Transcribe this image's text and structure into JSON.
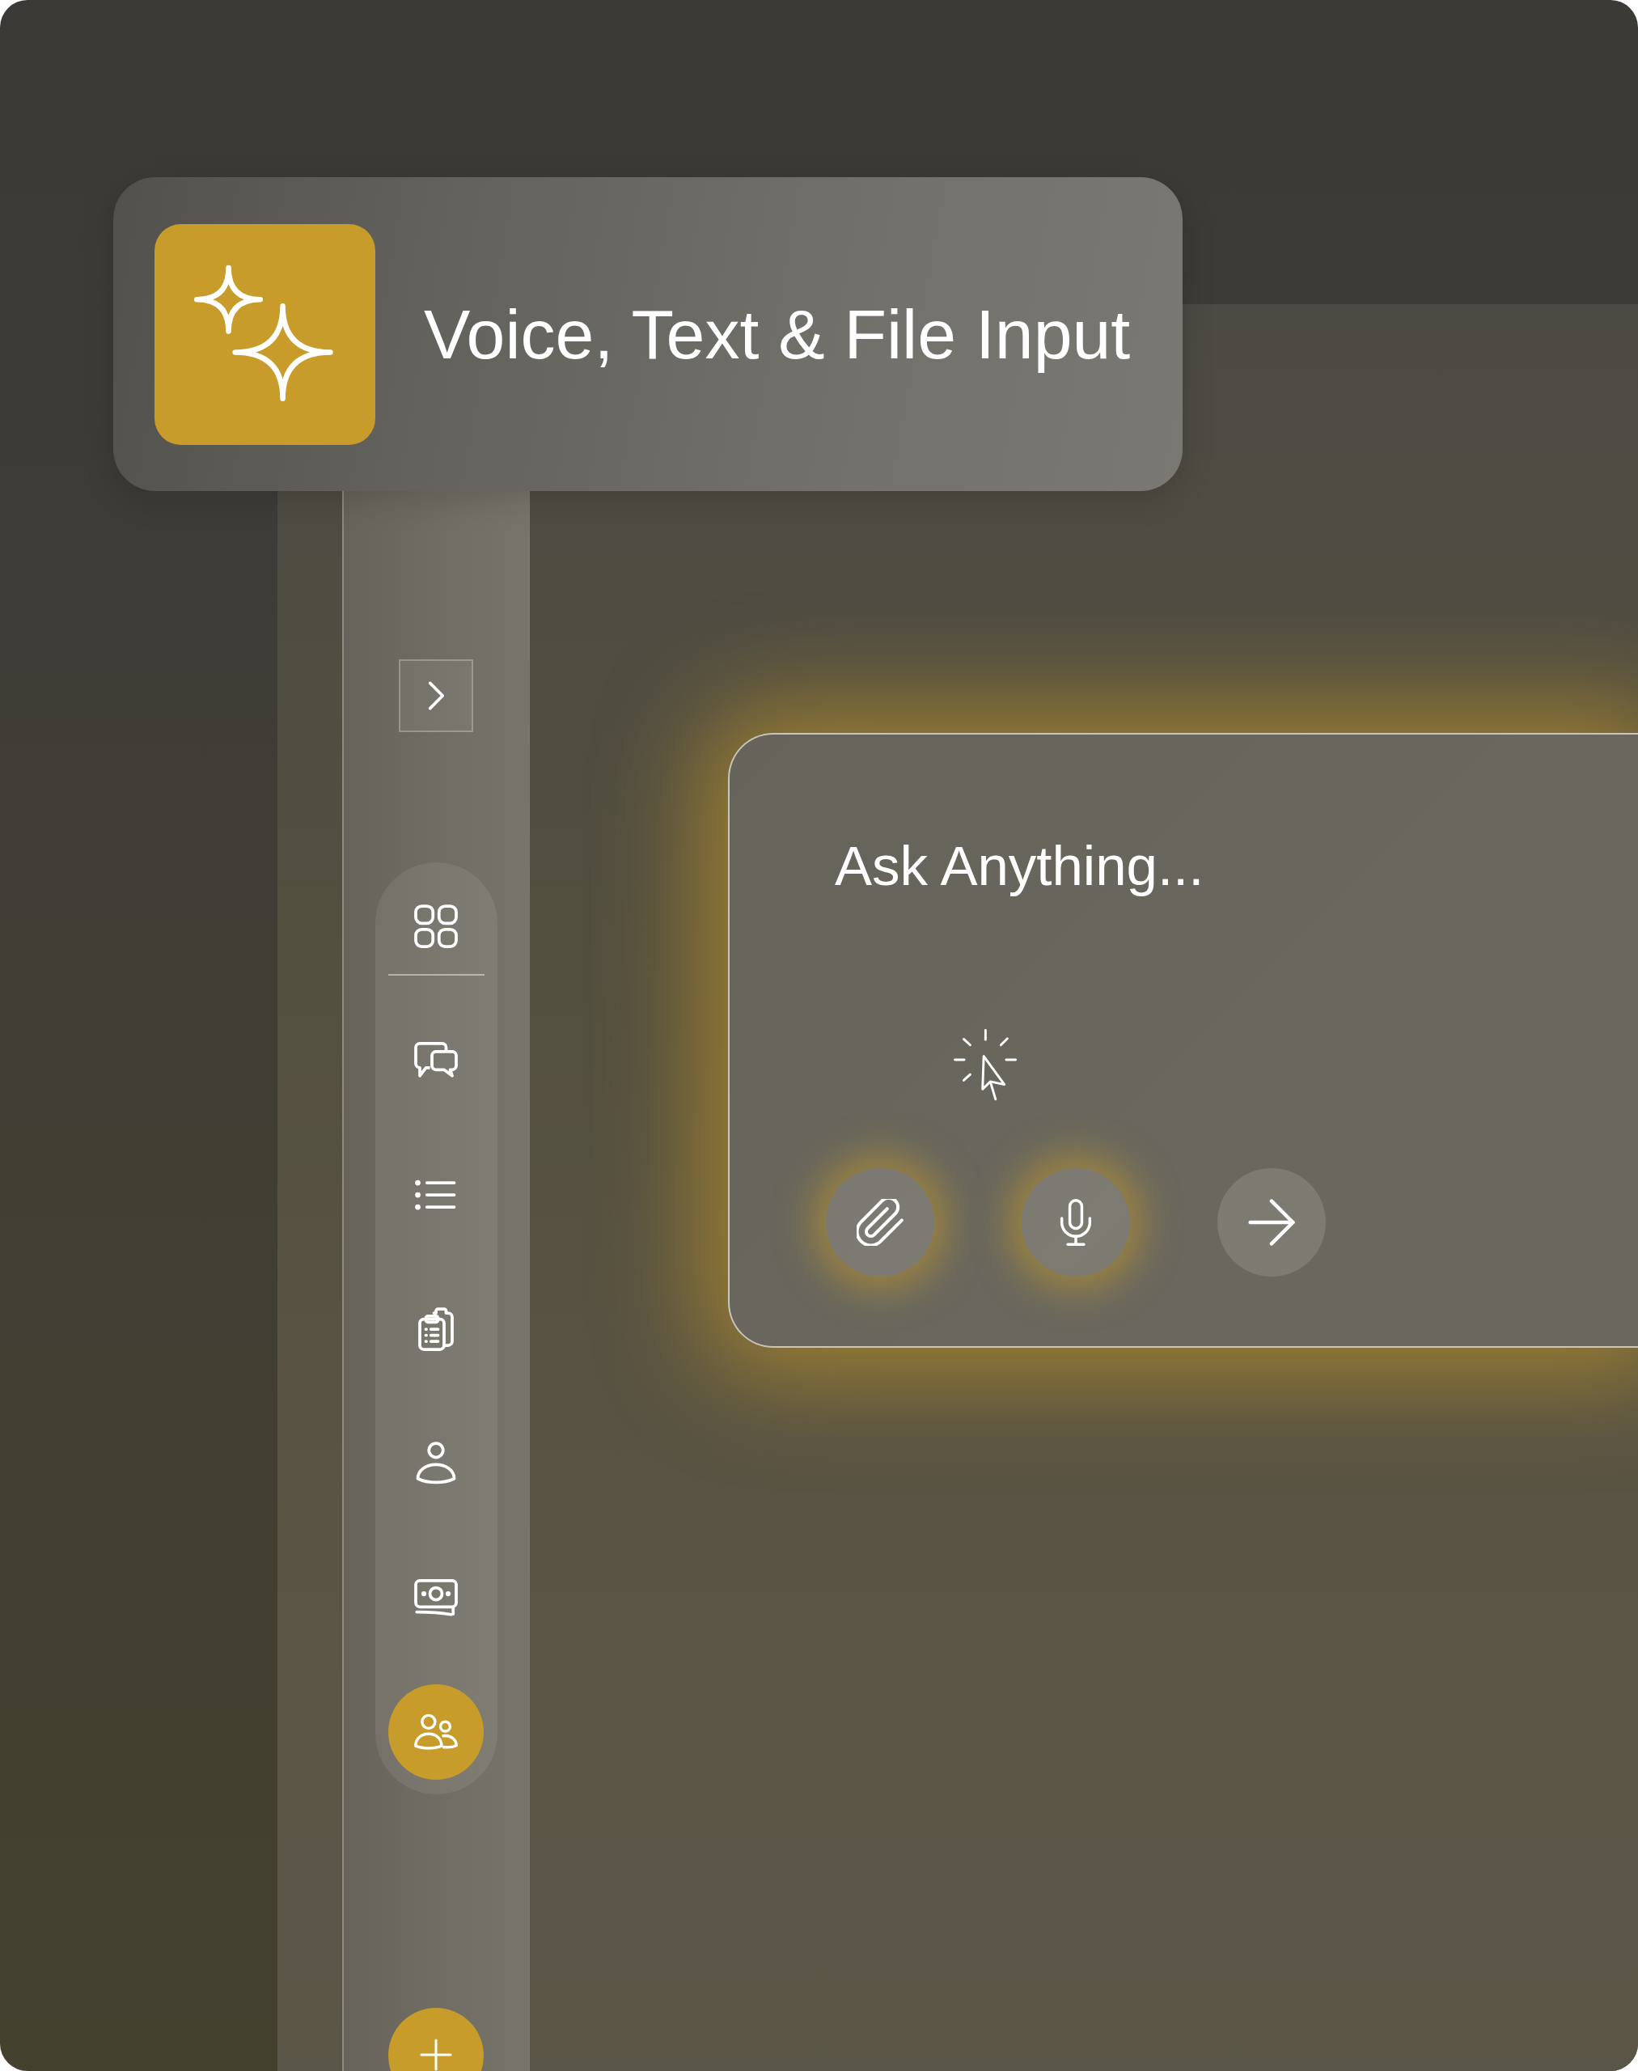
{
  "header": {
    "title": "Voice, Text & File Input"
  },
  "sidebar": {
    "items": [
      {
        "kind": "grid",
        "selected": false
      },
      {
        "kind": "chat",
        "selected": false
      },
      {
        "kind": "list",
        "selected": false
      },
      {
        "kind": "clipboard",
        "selected": false
      },
      {
        "kind": "user",
        "selected": false
      },
      {
        "kind": "money",
        "selected": false
      },
      {
        "kind": "users",
        "selected": true
      }
    ]
  },
  "prompt": {
    "placeholder": "Ask Anything...",
    "actions": [
      {
        "kind": "attach",
        "highlighted": true
      },
      {
        "kind": "mic",
        "highlighted": true
      },
      {
        "kind": "send",
        "highlighted": false
      }
    ]
  }
}
